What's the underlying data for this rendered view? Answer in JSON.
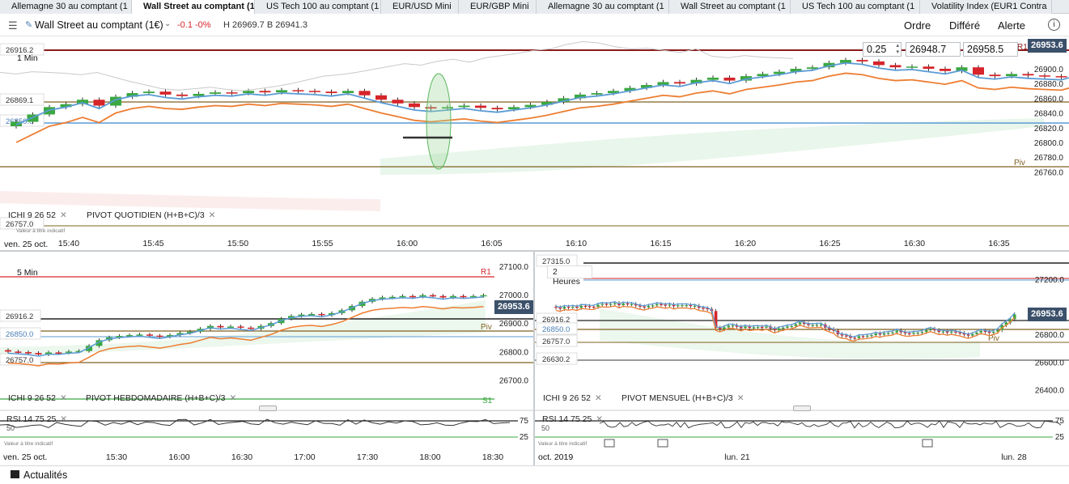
{
  "tabs": [
    {
      "label": "Allemagne 30 au comptant (1",
      "active": false
    },
    {
      "label": "Wall Street au comptant (1",
      "active": true
    },
    {
      "label": "US Tech 100 au comptant (1",
      "active": false
    },
    {
      "label": "EUR/USD Mini",
      "active": false
    },
    {
      "label": "EUR/GBP Mini",
      "active": false
    },
    {
      "label": "Allemagne 30 au comptant (1",
      "active": false
    },
    {
      "label": "Wall Street au comptant (1",
      "active": false
    },
    {
      "label": "US Tech 100 au comptant (1",
      "active": false
    },
    {
      "label": "Volatility Index (EUR1 Contra",
      "active": false
    }
  ],
  "header": {
    "title": "Wall Street au comptant (1€)",
    "change": "-0.1  -0%",
    "high_low": "H 26969.7  B 26941.3",
    "buttons": {
      "order": "Ordre",
      "deferred": "Différé",
      "alert": "Alerte"
    }
  },
  "order_ticket": {
    "size": "0.25",
    "sell": "26948.7",
    "buy": "26958.5"
  },
  "colors": {
    "bull": "#3aa840",
    "bear": "#d6242a",
    "tenkan": "#5b9bd5",
    "kijun": "#ed7d31",
    "pivot": "#7f6021",
    "price_tag": "#3b506a"
  },
  "main_chart": {
    "interval": "1 Min",
    "current_price": "26953.6",
    "r1_label": "R1",
    "piv_label": "Piv",
    "ind_ichi": "ICHI  9  26  52",
    "ind_pivot": "PIVOT  QUOTIDIEN  (H+B+C)/3",
    "disclaimer": "Valeur à titre indicatif",
    "date_label": "ven. 25 oct.",
    "level_labels": [
      "26916.2",
      "26869.1",
      "26850.0",
      "26757.0"
    ],
    "price_axis": [
      "26900.0",
      "26880.0",
      "26860.0",
      "26840.0",
      "26820.0",
      "26800.0",
      "26780.0",
      "26760.0"
    ],
    "time_axis": [
      "15:40",
      "15:45",
      "15:50",
      "15:55",
      "16:00",
      "16:05",
      "16:10",
      "16:15",
      "16:20",
      "16:25",
      "16:30",
      "16:35"
    ]
  },
  "chart_5min": {
    "interval": "5 Min",
    "current_price": "26953.6",
    "r1_label": "R1",
    "piv_label": "Piv",
    "s1_label": "S1",
    "ind_ichi": "ICHI  9  26  52",
    "ind_pivot": "PIVOT  HEBDOMADAIRE  (H+B+C)/3",
    "rsi_label": "RSI  14  75  25",
    "rsi_levels": [
      "75",
      "25",
      "50"
    ],
    "disclaimer": "Valeur à titre indicatif",
    "date_label": "ven. 25 oct.",
    "level_labels": [
      "26916.2",
      "26850.0",
      "26757.0"
    ],
    "price_axis": [
      "27100.0",
      "27000.0",
      "26900.0",
      "26800.0",
      "26700.0"
    ],
    "time_axis": [
      "15:30",
      "16:00",
      "16:30",
      "17:00",
      "17:30",
      "18:00",
      "18:30"
    ]
  },
  "chart_2h": {
    "interval": "2 Heures",
    "current_price": "26953.6",
    "piv_label": "Piv",
    "ind_ichi": "ICHI  9  26  52",
    "ind_pivot": "PIVOT  MENSUEL  (H+B+C)/3",
    "rsi_label": "RSI  14  75  25",
    "rsi_levels": [
      "75",
      "25",
      "50"
    ],
    "disclaimer": "Valeur à titre indicatif",
    "date_label": "oct. 2019",
    "level_labels": [
      "27315.0",
      "26916.2",
      "26850.0",
      "26757.0",
      "26630.2"
    ],
    "price_axis": [
      "27200.0",
      "26800.0",
      "26600.0",
      "26400.0"
    ],
    "time_axis": [
      "lun. 21",
      "lun. 28"
    ]
  },
  "footer": {
    "label": "Actualités"
  }
}
